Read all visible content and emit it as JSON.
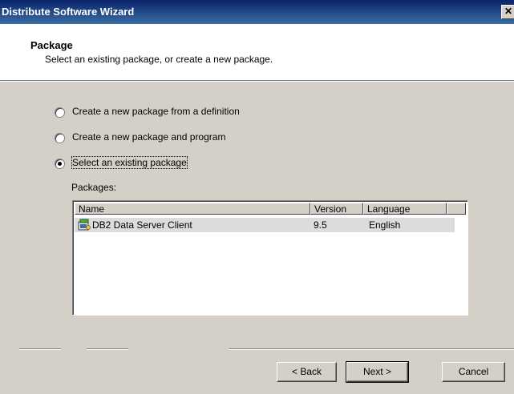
{
  "window": {
    "title": "Distribute Software Wizard",
    "close_glyph": "✕"
  },
  "header": {
    "title": "Package",
    "subtitle": "Select an existing package, or create a new package."
  },
  "options": [
    {
      "label": "Create a new package from a definition",
      "checked": false
    },
    {
      "label": "Create a new package and program",
      "checked": false
    },
    {
      "label": "Select an existing package",
      "checked": true
    }
  ],
  "packages": {
    "label": "Packages:",
    "columns": [
      "Name",
      "Version",
      "Language"
    ],
    "rows": [
      {
        "name": "DB2 Data Server Client",
        "version": "9.5",
        "language": "English",
        "icon": "package-icon"
      }
    ]
  },
  "buttons": {
    "back": "< Back",
    "next": "Next >",
    "cancel": "Cancel"
  }
}
